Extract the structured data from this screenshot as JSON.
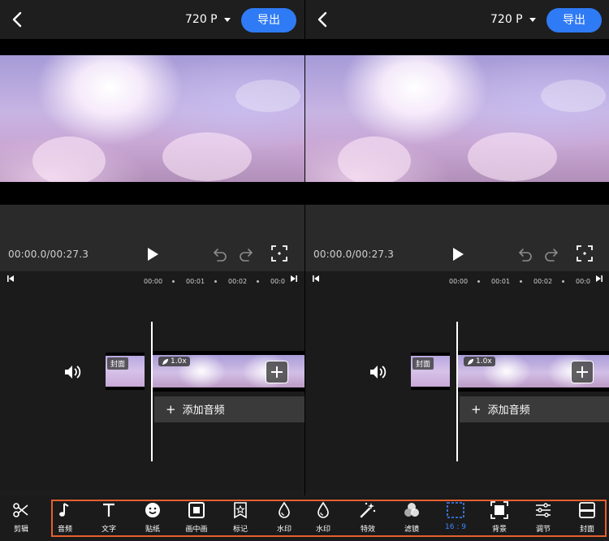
{
  "top": {
    "resolution": "720 P",
    "export_label": "导出"
  },
  "player": {
    "time": "00:00.0/00:27.3"
  },
  "ruler": [
    "00:00",
    "00:01",
    "00:02",
    "00:0"
  ],
  "timeline": {
    "cover_label": "封面",
    "speed": "1.0x",
    "add_audio": "添加音频"
  },
  "tools": [
    {
      "label": "剪辑",
      "icon": "scissors-icon"
    },
    {
      "label": "音频",
      "icon": "music-note-icon"
    },
    {
      "label": "文字",
      "icon": "text-icon"
    },
    {
      "label": "贴纸",
      "icon": "smiley-icon"
    },
    {
      "label": "画中画",
      "icon": "pip-icon"
    },
    {
      "label": "标记",
      "icon": "star-badge-icon"
    },
    {
      "label": "水印",
      "icon": "water-drop-icon"
    },
    {
      "label": "水印",
      "icon": "water-drop-icon"
    },
    {
      "label": "特效",
      "icon": "magic-wand-icon"
    },
    {
      "label": "滤镜",
      "icon": "filter-icon"
    },
    {
      "label": "16 : 9",
      "icon": "aspect-ratio-icon"
    },
    {
      "label": "背景",
      "icon": "background-icon"
    },
    {
      "label": "调节",
      "icon": "sliders-icon"
    },
    {
      "label": "封面",
      "icon": "cover-icon"
    }
  ],
  "colors": {
    "accent": "#2f7bf5",
    "selected_tool": "#3f86ff",
    "highlight_border": "#e4602f"
  }
}
